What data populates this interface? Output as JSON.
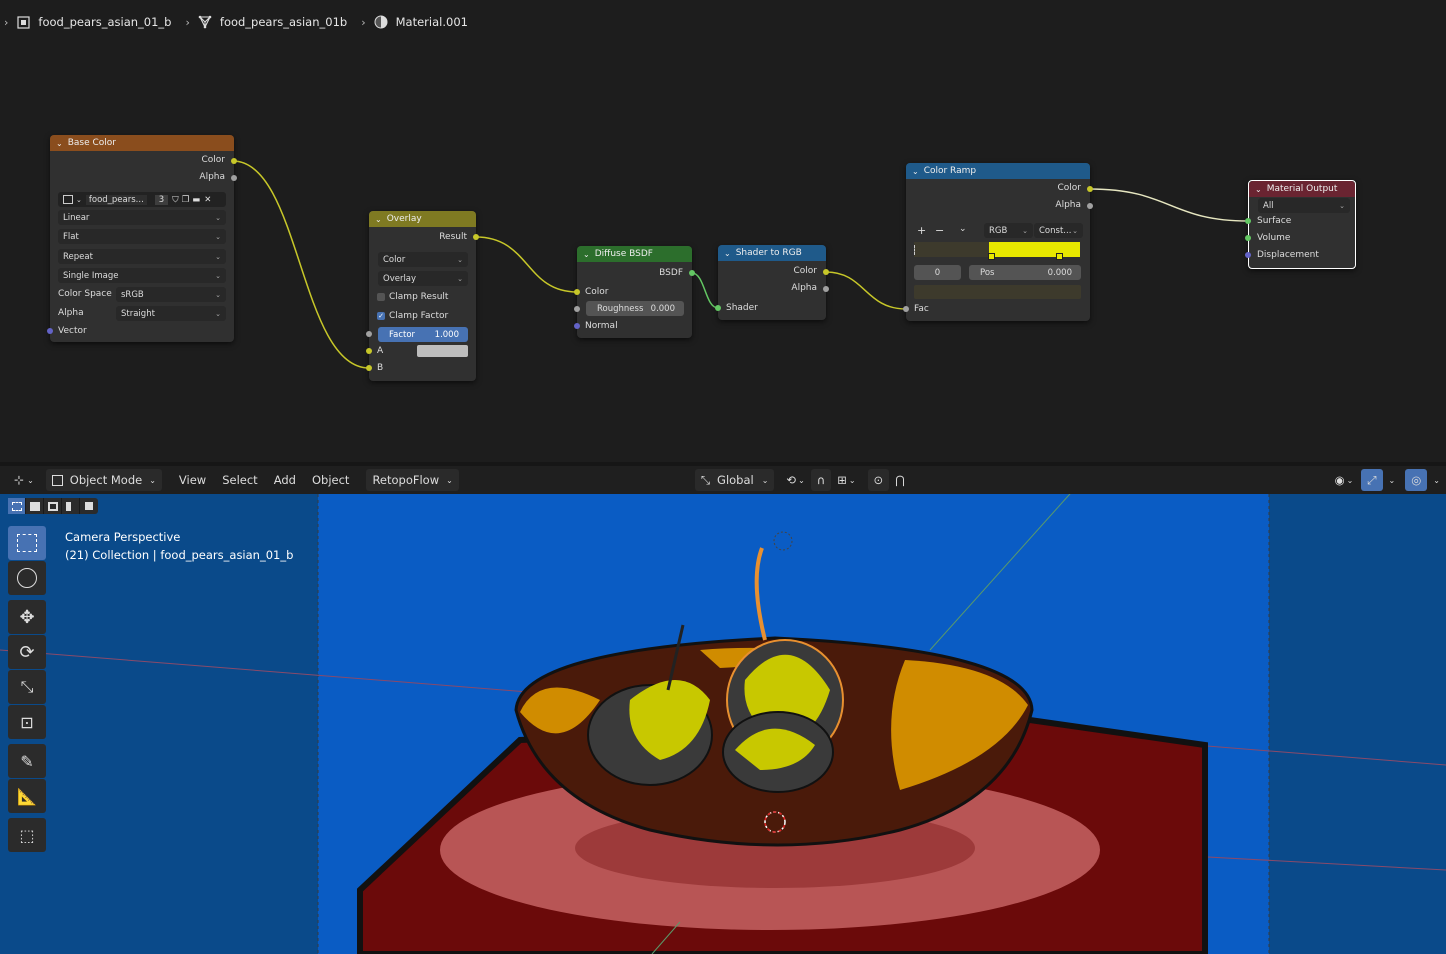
{
  "breadcrumb": {
    "object": "food_pears_asian_01_b",
    "mesh": "food_pears_asian_01b",
    "material": "Material.001"
  },
  "nodes": {
    "base_color": {
      "title": "Base Color",
      "out_color": "Color",
      "out_alpha": "Alpha",
      "image_name": "food_pears...",
      "users": "3",
      "interpolation": "Linear",
      "projection": "Flat",
      "extension": "Repeat",
      "source": "Single Image",
      "color_space_label": "Color Space",
      "color_space": "sRGB",
      "alpha_label": "Alpha",
      "alpha_mode": "Straight",
      "in_vector": "Vector"
    },
    "overlay": {
      "title": "Overlay",
      "out_result": "Result",
      "data_type": "Color",
      "blend_mode": "Overlay",
      "clamp_result": "Clamp Result",
      "clamp_factor": "Clamp Factor",
      "factor_label": "Factor",
      "factor_value": "1.000",
      "in_a": "A",
      "in_b": "B"
    },
    "diffuse": {
      "title": "Diffuse BSDF",
      "out_bsdf": "BSDF",
      "in_color": "Color",
      "roughness_label": "Roughness",
      "roughness_value": "0.000",
      "in_normal": "Normal"
    },
    "shader_to_rgb": {
      "title": "Shader to RGB",
      "out_color": "Color",
      "out_alpha": "Alpha",
      "in_shader": "Shader"
    },
    "color_ramp": {
      "title": "Color Ramp",
      "out_color": "Color",
      "out_alpha": "Alpha",
      "add": "+",
      "remove": "−",
      "color_mode": "RGB",
      "interpolation": "Const...",
      "index": "0",
      "pos_label": "Pos",
      "pos_value": "0.000",
      "in_fac": "Fac"
    },
    "material_output": {
      "title": "Material Output",
      "target": "All",
      "in_surface": "Surface",
      "in_volume": "Volume",
      "in_displacement": "Displacement"
    }
  },
  "viewport": {
    "mode": "Object Mode",
    "menus": [
      "View",
      "Select",
      "Add",
      "Object"
    ],
    "addon_menu": "RetopoFlow",
    "transform_orientation": "Global",
    "info_line1": "Camera Perspective",
    "info_line2": "(21) Collection | food_pears_asian_01_b"
  },
  "colors": {
    "node_header_texture": "#8a4d1d",
    "node_header_color": "#7f7a22",
    "node_header_shader": "#2c6e2c",
    "node_header_converter": "#1f5a8a",
    "node_header_output": "#6a2431",
    "socket_color": "#c7c729",
    "socket_shader": "#63c763",
    "socket_vector": "#6363c7",
    "accent_blue": "#4772b3",
    "viewport_bg": "#0a4a8a",
    "ramp_yellow": "#e8e800"
  },
  "icons": {
    "object": "object-icon",
    "mesh": "mesh-icon",
    "material": "material-icon"
  }
}
